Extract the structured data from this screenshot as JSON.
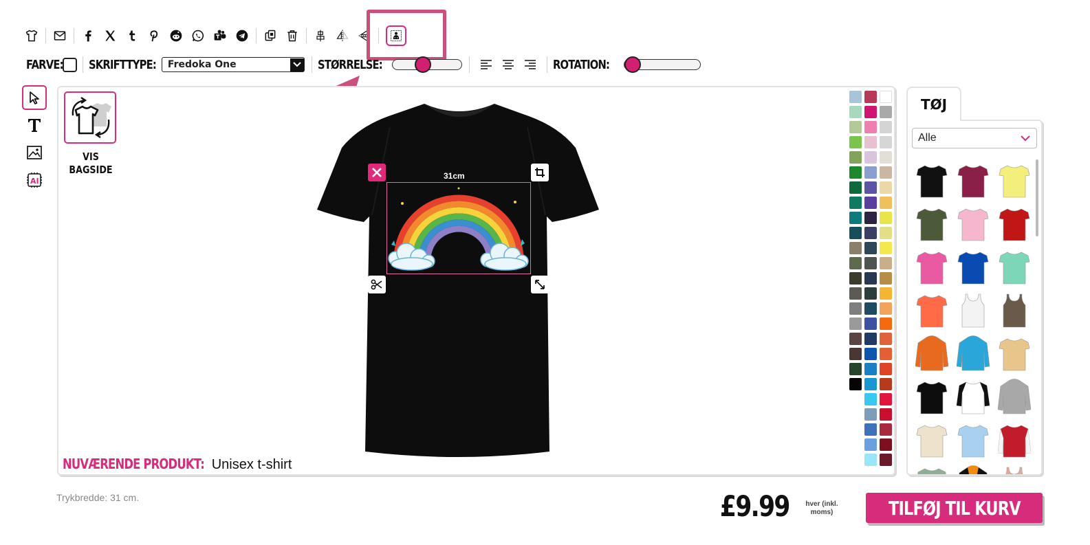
{
  "toolbar": {
    "icons": [
      "tshirt-icon",
      "envelope-icon",
      "facebook-icon",
      "x-icon",
      "tumblr-icon",
      "pinterest-icon",
      "reddit-icon",
      "whatsapp-icon",
      "teams-icon",
      "telegram-icon",
      "duplicate-icon",
      "trash-icon",
      "align-center-icon",
      "flip-horizontal-icon",
      "flip-vertical-icon",
      "remove-background-icon"
    ]
  },
  "options": {
    "color_label": "FARVE:",
    "font_label": "SKRIFTTYPE:",
    "font_value": "Fredoka One",
    "size_label": "STØRRELSE:",
    "size_level": 0.4,
    "rotation_label": "ROTATION:",
    "rotation_level": 0.0
  },
  "canvas": {
    "backside_label_1": "VIS",
    "backside_label_2": "BAGSIDE",
    "design_width": "31cm",
    "current_product_label": "NUVÆRENDE PRODUKT:",
    "current_product_value": "Unisex t-shirt",
    "shirt_color": "#0d0d0d"
  },
  "palette": [
    "#a7c4d8",
    "#b63a58",
    "#ffffff",
    "#a8d9bf",
    "#d0146f",
    "#a9a9a9",
    "#b3c997",
    "#ef7fb0",
    "#d4d4d4",
    "#7bc44b",
    "#e8c0cf",
    "#d6d6d6",
    "#7fa45a",
    "#d8c4dc",
    "#e3ded6",
    "#1c8a2c",
    "#8a9ed0",
    "#c9b7a3",
    "#0d6b3b",
    "#5c55a3",
    "#ecd7a8",
    "#0f7a5f",
    "#5a3f9e",
    "#f0c05a",
    "#0f7a7e",
    "#2c2440",
    "#e8e44a",
    "#184e5a",
    "#3a3f63",
    "#e2df86",
    "#8a7f6a",
    "#2e4757",
    "#f3e84c",
    "#5d6a4e",
    "#4f5352",
    "#c9ae8a",
    "#3c3c2c",
    "#283752",
    "#b88d46",
    "#5c5a53",
    "#2e3e3c",
    "#f5b533",
    "#7f7f7f",
    "#1e4b5e",
    "#f3a45c",
    "#9a9a9a",
    "#3d51a2",
    "#f46a0c",
    "#5b4444",
    "#203a63",
    "#e0623a",
    "#4a3632",
    "#0d56b0",
    "#e46034",
    "#26452a",
    "#1a7fc3",
    "#e04426",
    "#050505",
    "#1997d1",
    "#b73a1c",
    "",
    "#38c8f0",
    "#e0143c",
    "",
    "#7f9cb8",
    "#c8102e",
    "",
    "#3f72ba",
    "#a82a3c",
    "",
    "#6b9fe0",
    "#7e0f20",
    "",
    "#9ae6f8",
    "#6b1a2a"
  ],
  "right_panel": {
    "tab_label": "TØJ",
    "category_value": "Alle",
    "products": [
      {
        "name": "black-tee",
        "color": "#111111",
        "type": "tee"
      },
      {
        "name": "burgundy-womens-tee",
        "color": "#8a1f48",
        "type": "tee"
      },
      {
        "name": "yellow-tee",
        "color": "#f4ee7a",
        "type": "tee"
      },
      {
        "name": "olive-tee",
        "color": "#4c5a3a",
        "type": "tee"
      },
      {
        "name": "pink-womens-tee",
        "color": "#f6b6cd",
        "type": "tee"
      },
      {
        "name": "red-tee",
        "color": "#c01616",
        "type": "tee"
      },
      {
        "name": "magenta-womens-tee",
        "color": "#e95aa3",
        "type": "tee"
      },
      {
        "name": "royal-blue-tee",
        "color": "#0a4bb2",
        "type": "tee"
      },
      {
        "name": "mint-tee",
        "color": "#7dd6b8",
        "type": "tee"
      },
      {
        "name": "coral-tee",
        "color": "#ff6b47",
        "type": "tee"
      },
      {
        "name": "white-tank",
        "color": "#f3f3f3",
        "type": "tank"
      },
      {
        "name": "brown-tank",
        "color": "#6a5a4a",
        "type": "tank"
      },
      {
        "name": "orange-hoodie",
        "color": "#e76a1f",
        "type": "hoodie"
      },
      {
        "name": "turquoise-hoodie",
        "color": "#2aa6d8",
        "type": "hoodie"
      },
      {
        "name": "tie-dye-tee",
        "color": "#e8c58a",
        "type": "tee"
      },
      {
        "name": "black-tee-2",
        "color": "#0d0d0d",
        "type": "tee"
      },
      {
        "name": "raglan-tee",
        "color": "#ffffff",
        "type": "raglan"
      },
      {
        "name": "grey-hoodie",
        "color": "#a8a8a8",
        "type": "hoodie"
      },
      {
        "name": "cream-tee",
        "color": "#efe2cc",
        "type": "tee"
      },
      {
        "name": "ombre-blue-tee",
        "color": "#a9d1ef",
        "type": "tee"
      },
      {
        "name": "varsity-jacket",
        "color": "#c21b2c",
        "type": "jacket"
      },
      {
        "name": "sage-longsleeve",
        "color": "#8fae95",
        "type": "longsleeve"
      },
      {
        "name": "black-orange-hoodie",
        "color": "#111111",
        "type": "hoodie"
      },
      {
        "name": "peach-tank",
        "color": "#e9a79a",
        "type": "tank"
      }
    ]
  },
  "footer": {
    "print_width": "Trykbredde: 31 cm.",
    "price": "£9.99",
    "price_note_1": "hver (inkl.",
    "price_note_2": "moms)",
    "cta": "TILFØJ TIL KURV"
  },
  "accent": "#d72b7c"
}
